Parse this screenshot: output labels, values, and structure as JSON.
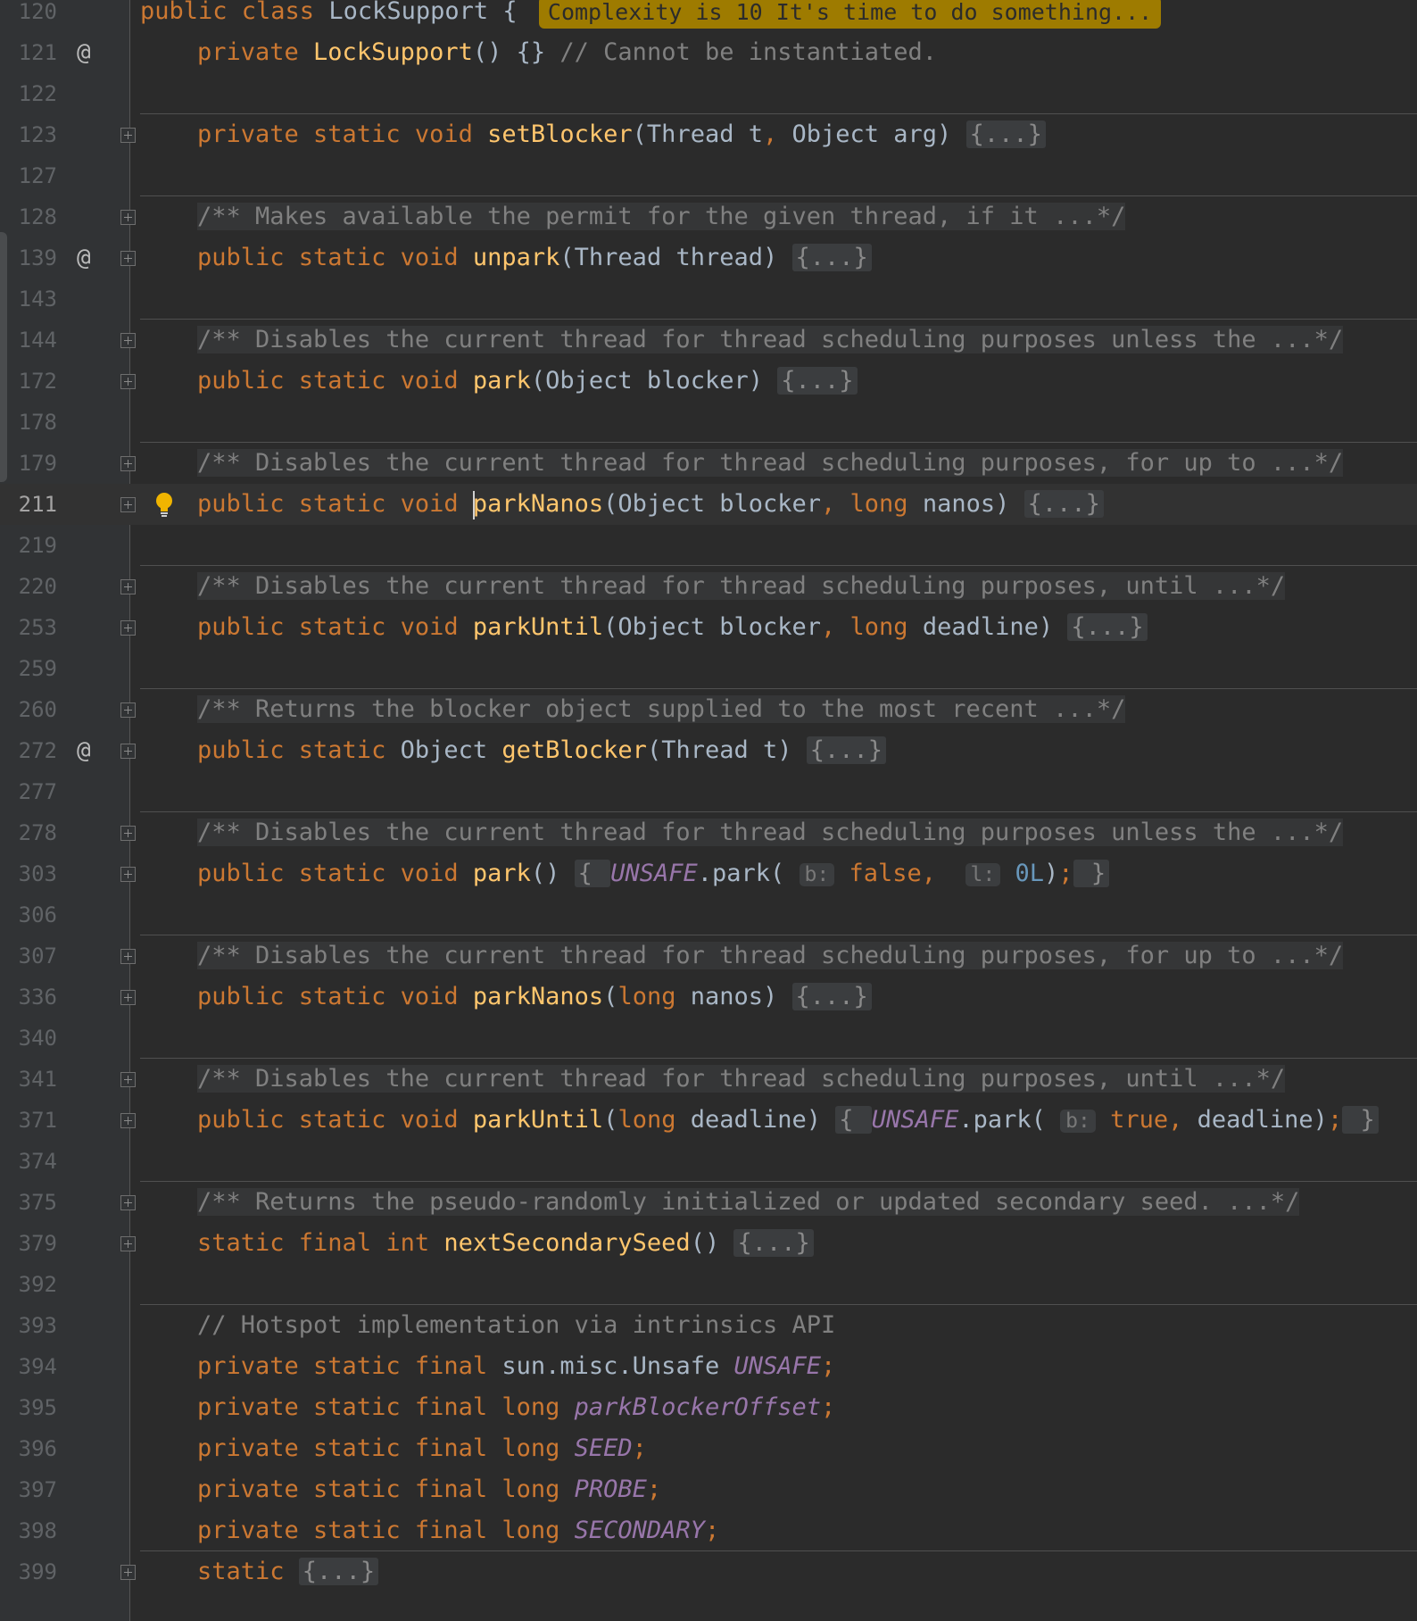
{
  "editor": {
    "lines": [
      {
        "n": "120",
        "segs": [
          [
            "kw",
            "public class "
          ],
          [
            "plain",
            "LockSupport { "
          ]
        ],
        "badge": "Complexity is 10 It's time to do something..."
      },
      {
        "n": "121",
        "mark": "@",
        "segs": [
          [
            "kw",
            "private "
          ],
          [
            "fn",
            "LockSupport"
          ],
          [
            "plain",
            "() {} "
          ],
          [
            "cm",
            "// Cannot be instantiated."
          ]
        ]
      },
      {
        "n": "122",
        "sep": true,
        "segs": []
      },
      {
        "n": "123",
        "fold": true,
        "segs": [
          [
            "kw",
            "private static void "
          ],
          [
            "fn",
            "setBlocker"
          ],
          [
            "plain",
            "(Thread t"
          ],
          [
            "kw",
            ", "
          ],
          [
            "plain",
            "Object arg) "
          ],
          [
            "box",
            "{...}"
          ]
        ]
      },
      {
        "n": "127",
        "sep": true,
        "segs": []
      },
      {
        "n": "128",
        "fold": true,
        "segs": [
          [
            "doc",
            "/** Makes available the permit for the given thread, if it ...*/"
          ]
        ]
      },
      {
        "n": "139",
        "mark": "@",
        "fold": true,
        "segs": [
          [
            "kw",
            "public static void "
          ],
          [
            "fn",
            "unpark"
          ],
          [
            "plain",
            "(Thread thread) "
          ],
          [
            "box",
            "{...}"
          ]
        ]
      },
      {
        "n": "143",
        "sep": true,
        "segs": []
      },
      {
        "n": "144",
        "fold": true,
        "segs": [
          [
            "doc",
            "/** Disables the current thread for thread scheduling purposes unless the ...*/"
          ]
        ]
      },
      {
        "n": "172",
        "fold": true,
        "segs": [
          [
            "kw",
            "public static void "
          ],
          [
            "fn",
            "park"
          ],
          [
            "plain",
            "(Object blocker) "
          ],
          [
            "box",
            "{...}"
          ]
        ]
      },
      {
        "n": "178",
        "sep": true,
        "segs": []
      },
      {
        "n": "179",
        "fold": true,
        "segs": [
          [
            "doc",
            "/** Disables the current thread for thread scheduling purposes, for up to ...*/"
          ]
        ]
      },
      {
        "n": "211",
        "current": true,
        "bulb": true,
        "fold": true,
        "segs": [
          [
            "kw",
            "public static void "
          ],
          [
            "caret",
            ""
          ],
          [
            "fn",
            "parkNanos"
          ],
          [
            "plain",
            "(Object blocker"
          ],
          [
            "kw",
            ", long "
          ],
          [
            "plain",
            "nanos) "
          ],
          [
            "box",
            "{...}"
          ]
        ]
      },
      {
        "n": "219",
        "sep": true,
        "segs": []
      },
      {
        "n": "220",
        "fold": true,
        "segs": [
          [
            "doc",
            "/** Disables the current thread for thread scheduling purposes, until ...*/"
          ]
        ]
      },
      {
        "n": "253",
        "fold": true,
        "segs": [
          [
            "kw",
            "public static void "
          ],
          [
            "fn",
            "parkUntil"
          ],
          [
            "plain",
            "(Object blocker"
          ],
          [
            "kw",
            ", long "
          ],
          [
            "plain",
            "deadline) "
          ],
          [
            "box",
            "{...}"
          ]
        ]
      },
      {
        "n": "259",
        "sep": true,
        "segs": []
      },
      {
        "n": "260",
        "fold": true,
        "segs": [
          [
            "doc",
            "/** Returns the blocker object supplied to the most recent ...*/"
          ]
        ]
      },
      {
        "n": "272",
        "mark": "@",
        "fold": true,
        "segs": [
          [
            "kw",
            "public static "
          ],
          [
            "plain",
            "Object "
          ],
          [
            "fn",
            "getBlocker"
          ],
          [
            "plain",
            "(Thread t) "
          ],
          [
            "box",
            "{...}"
          ]
        ]
      },
      {
        "n": "277",
        "sep": true,
        "segs": []
      },
      {
        "n": "278",
        "fold": true,
        "segs": [
          [
            "doc",
            "/** Disables the current thread for thread scheduling purposes unless the ...*/"
          ]
        ]
      },
      {
        "n": "303",
        "fold": true,
        "segs": [
          [
            "kw",
            "public static void "
          ],
          [
            "fn",
            "park"
          ],
          [
            "plain",
            "() "
          ],
          [
            "box",
            "{ "
          ],
          [
            "st",
            "UNSAFE"
          ],
          [
            "plain",
            ".park( "
          ],
          [
            "hint",
            "b:"
          ],
          [
            "kw",
            " false,  "
          ],
          [
            "hint",
            "l:"
          ],
          [
            "num",
            " 0L"
          ],
          [
            "plain",
            ")"
          ],
          [
            "kw",
            ";"
          ],
          [
            "box",
            " }"
          ]
        ]
      },
      {
        "n": "306",
        "sep": true,
        "segs": []
      },
      {
        "n": "307",
        "fold": true,
        "segs": [
          [
            "doc",
            "/** Disables the current thread for thread scheduling purposes, for up to ...*/"
          ]
        ]
      },
      {
        "n": "336",
        "fold": true,
        "segs": [
          [
            "kw",
            "public static void "
          ],
          [
            "fn",
            "parkNanos"
          ],
          [
            "plain",
            "("
          ],
          [
            "kw",
            "long "
          ],
          [
            "plain",
            "nanos) "
          ],
          [
            "box",
            "{...}"
          ]
        ]
      },
      {
        "n": "340",
        "sep": true,
        "segs": []
      },
      {
        "n": "341",
        "fold": true,
        "segs": [
          [
            "doc",
            "/** Disables the current thread for thread scheduling purposes, until ...*/"
          ]
        ]
      },
      {
        "n": "371",
        "fold": true,
        "segs": [
          [
            "kw",
            "public static void "
          ],
          [
            "fn",
            "parkUntil"
          ],
          [
            "plain",
            "("
          ],
          [
            "kw",
            "long "
          ],
          [
            "plain",
            "deadline) "
          ],
          [
            "box",
            "{ "
          ],
          [
            "st",
            "UNSAFE"
          ],
          [
            "plain",
            ".park( "
          ],
          [
            "hint",
            "b:"
          ],
          [
            "kw",
            " true, "
          ],
          [
            "plain",
            "deadline)"
          ],
          [
            "kw",
            ";"
          ],
          [
            "box",
            " }"
          ]
        ]
      },
      {
        "n": "374",
        "sep": true,
        "segs": []
      },
      {
        "n": "375",
        "fold": true,
        "segs": [
          [
            "doc",
            "/** Returns the pseudo-randomly initialized or updated secondary seed. ...*/"
          ]
        ]
      },
      {
        "n": "379",
        "fold": true,
        "segs": [
          [
            "kw",
            "static final int "
          ],
          [
            "fn",
            "nextSecondarySeed"
          ],
          [
            "plain",
            "() "
          ],
          [
            "box",
            "{...}"
          ]
        ]
      },
      {
        "n": "392",
        "sep": true,
        "segs": []
      },
      {
        "n": "393",
        "segs": [
          [
            "cm",
            "// Hotspot implementation via intrinsics API"
          ]
        ]
      },
      {
        "n": "394",
        "segs": [
          [
            "kw",
            "private static final "
          ],
          [
            "plain",
            "sun.misc.Unsafe "
          ],
          [
            "st",
            "UNSAFE"
          ],
          [
            "kw",
            ";"
          ]
        ]
      },
      {
        "n": "395",
        "segs": [
          [
            "kw",
            "private static final long "
          ],
          [
            "st",
            "parkBlockerOffset"
          ],
          [
            "kw",
            ";"
          ]
        ]
      },
      {
        "n": "396",
        "segs": [
          [
            "kw",
            "private static final long "
          ],
          [
            "st",
            "SEED"
          ],
          [
            "kw",
            ";"
          ]
        ]
      },
      {
        "n": "397",
        "segs": [
          [
            "kw",
            "private static final long "
          ],
          [
            "st",
            "PROBE"
          ],
          [
            "kw",
            ";"
          ]
        ]
      },
      {
        "n": "398",
        "sep": true,
        "segs": [
          [
            "kw",
            "private static final long "
          ],
          [
            "st",
            "SECONDARY"
          ],
          [
            "kw",
            ";"
          ]
        ]
      },
      {
        "n": "399",
        "fold": true,
        "segs": [
          [
            "kw",
            "static "
          ],
          [
            "box",
            "{...}"
          ]
        ]
      }
    ]
  }
}
